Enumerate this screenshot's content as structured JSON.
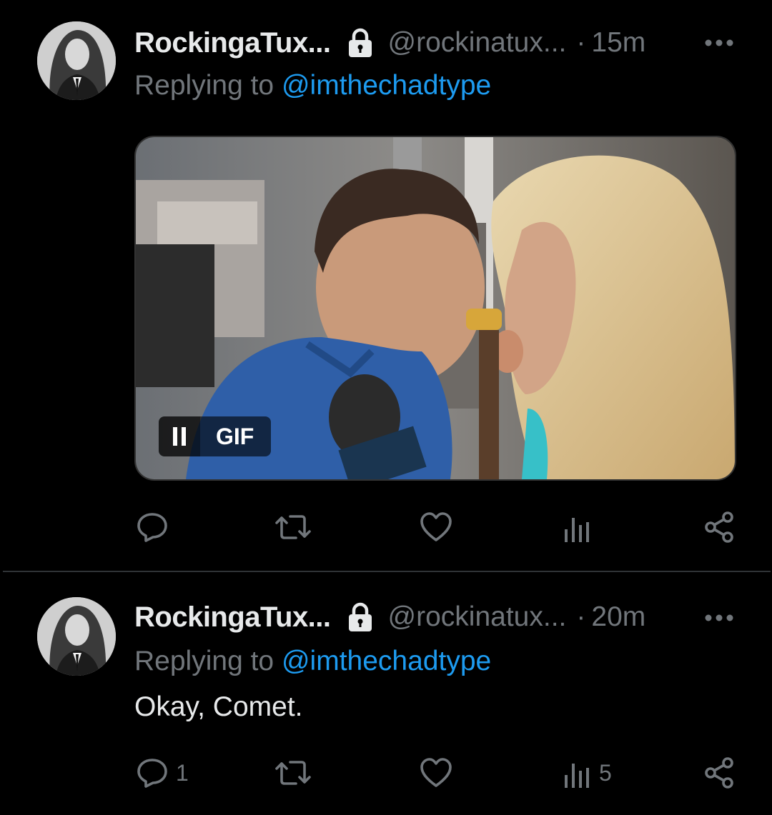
{
  "tweets": [
    {
      "display_name": "RockingaTux...",
      "handle": "@rockinatux...",
      "separator": "·",
      "time": "15m",
      "replying_prefix": "Replying to",
      "replying_to": "@imthechadtype",
      "text": "",
      "media": {
        "type": "gif",
        "badge_label": "GIF",
        "state": "playing"
      },
      "actions": {
        "reply_count": "",
        "retweet_count": "",
        "like_count": "",
        "views_count": ""
      }
    },
    {
      "display_name": "RockingaTux...",
      "handle": "@rockinatux...",
      "separator": "·",
      "time": "20m",
      "replying_prefix": "Replying to",
      "replying_to": "@imthechadtype",
      "text": "Okay, Comet.",
      "actions": {
        "reply_count": "1",
        "retweet_count": "",
        "like_count": "",
        "views_count": "5"
      }
    }
  ],
  "colors": {
    "background": "#000000",
    "text_primary": "#e7e9ea",
    "text_secondary": "#71767b",
    "link": "#1d9bf0",
    "divider": "#2f3336"
  },
  "icons": [
    "lock-icon",
    "more-icon",
    "reply-icon",
    "retweet-icon",
    "like-icon",
    "views-icon",
    "share-icon",
    "pause-icon"
  ]
}
